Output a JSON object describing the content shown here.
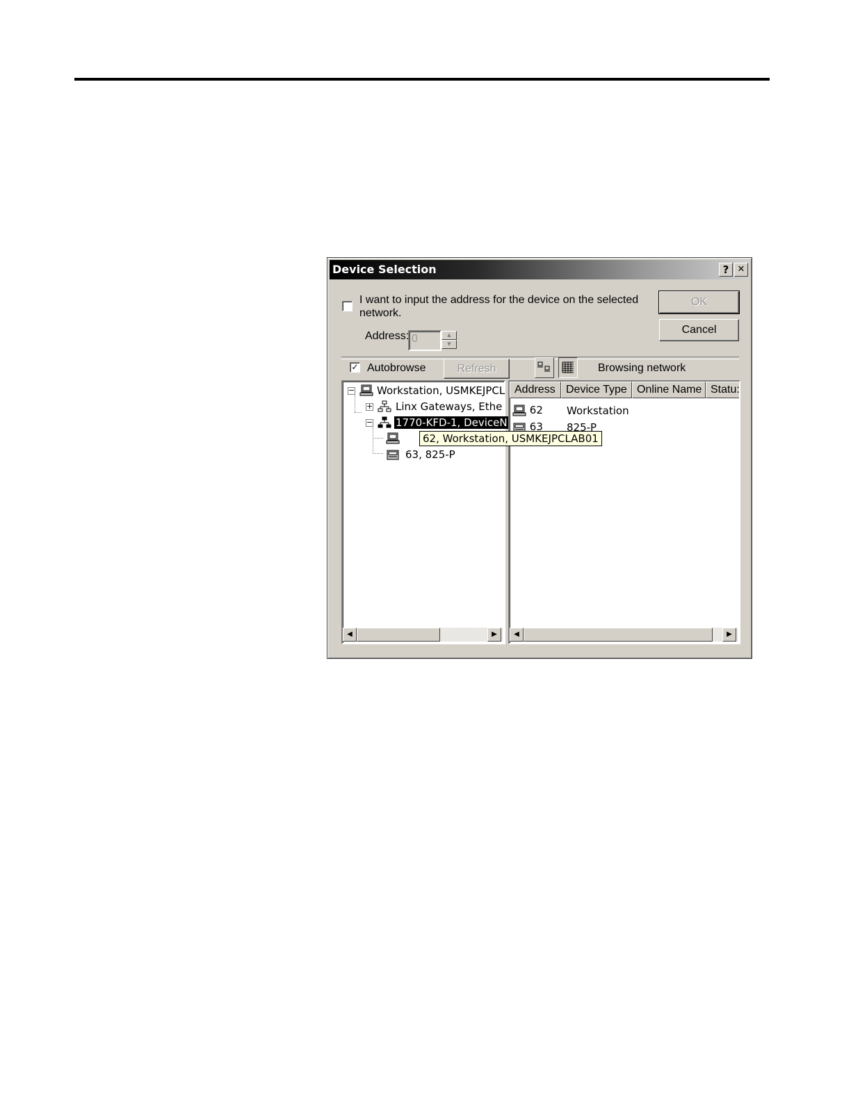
{
  "dialog": {
    "title": "Device Selection",
    "help_button": "?",
    "close_button": "✕",
    "manual_checkbox_label_line1": "I want to input the address for the device on the selected",
    "manual_checkbox_label_line2": "network.",
    "manual_checkbox_checked": false,
    "address_label": "Address:",
    "address_value": "0",
    "ok_label": "OK",
    "cancel_label": "Cancel",
    "autobrowse_label": "Autobrowse",
    "autobrowse_checked": true,
    "refresh_label": "Refresh",
    "status_text": "Browsing network"
  },
  "tree": {
    "items": [
      {
        "label": "Workstation, USMKEJPCL",
        "icon": "workstation-icon",
        "expander": "−"
      },
      {
        "label": "Linx Gateways, Ethe",
        "icon": "network-icon",
        "expander": "+"
      },
      {
        "label": "1770-KFD-1, DeviceN",
        "icon": "network-icon",
        "expander": "−"
      },
      {
        "label": "62, Workstation, USMKEJPCLAB01",
        "icon": "workstation-icon"
      },
      {
        "label": "63, 825-P",
        "icon": "device-icon"
      }
    ]
  },
  "list": {
    "columns": [
      "Address",
      "Device Type",
      "Online Name",
      "Statu:"
    ],
    "rows": [
      {
        "address": "62",
        "device_type": "Workstation",
        "icon": "workstation-icon"
      },
      {
        "address": "63",
        "device_type": "825-P",
        "icon": "device-icon"
      }
    ]
  },
  "colors": {
    "title_start": "#000000",
    "title_end": "#d0d0d0",
    "face": "#d4d0c8",
    "tooltip": "#ffffe1"
  }
}
